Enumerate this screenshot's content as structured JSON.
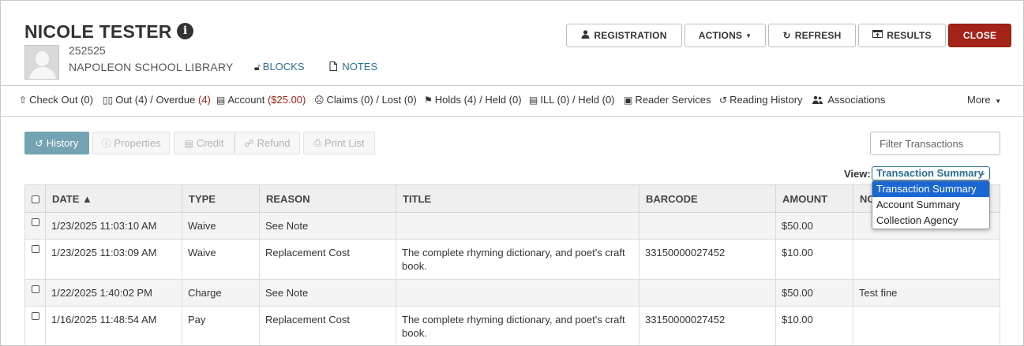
{
  "patron": {
    "name": "NICOLE TESTER",
    "barcode": "252525",
    "library": "NAPOLEON SCHOOL LIBRARY",
    "blocks_label": "BLOCKS",
    "notes_label": "NOTES"
  },
  "header_buttons": {
    "registration": "REGISTRATION",
    "actions": "ACTIONS",
    "refresh": "REFRESH",
    "results": "RESULTS",
    "close": "CLOSE"
  },
  "nav": {
    "checkout": "Check Out (0)",
    "out": "Out (4) / Overdue ",
    "overdue_count": "(4)",
    "account": "Account ",
    "account_balance": "($25.00)",
    "claims": "Claims (0) / Lost (0)",
    "holds": "Holds (4) / Held (0)",
    "ill": "ILL (0) / Held (0)",
    "reader_services": "Reader Services",
    "reading_history": "Reading History",
    "associations": "Associations",
    "more": "More"
  },
  "toolbar": {
    "history": "History",
    "properties": "Properties",
    "credit": "Credit",
    "refund": "Refund",
    "print_list": "Print List",
    "filter_placeholder": "Filter Transactions",
    "view_label": "View:",
    "view_selected": "Transaction Summary",
    "view_options": [
      "Transaction Summary",
      "Account Summary",
      "Collection Agency"
    ]
  },
  "table": {
    "columns": [
      "DATE ▲",
      "TYPE",
      "REASON",
      "TITLE",
      "BARCODE",
      "AMOUNT",
      "NC"
    ],
    "rows": [
      {
        "date": "1/23/2025 11:03:10 AM",
        "type": "Waive",
        "reason": "See Note",
        "title": "",
        "barcode": "",
        "amount": "$50.00",
        "note": ""
      },
      {
        "date": "1/23/2025 11:03:09 AM",
        "type": "Waive",
        "reason": "Replacement Cost",
        "title": "The complete rhyming dictionary, and poet's craft book.",
        "barcode": "33150000027452",
        "amount": "$10.00",
        "note": ""
      },
      {
        "date": "1/22/2025 1:40:02 PM",
        "type": "Charge",
        "reason": "See Note",
        "title": "",
        "barcode": "",
        "amount": "$50.00",
        "note": "Test fine"
      },
      {
        "date": "1/16/2025 11:48:54 AM",
        "type": "Pay",
        "reason": "Replacement Cost",
        "title": "The complete rhyming dictionary, and poet's craft book.",
        "barcode": "33150000027452",
        "amount": "$10.00",
        "note": ""
      }
    ]
  },
  "colors": {
    "accent": "#2a6f8e",
    "close_button": "#a32319",
    "active_tab": "#74a3b3",
    "balance_red": "#a32319",
    "dropdown_selected": "#1a66d2"
  }
}
